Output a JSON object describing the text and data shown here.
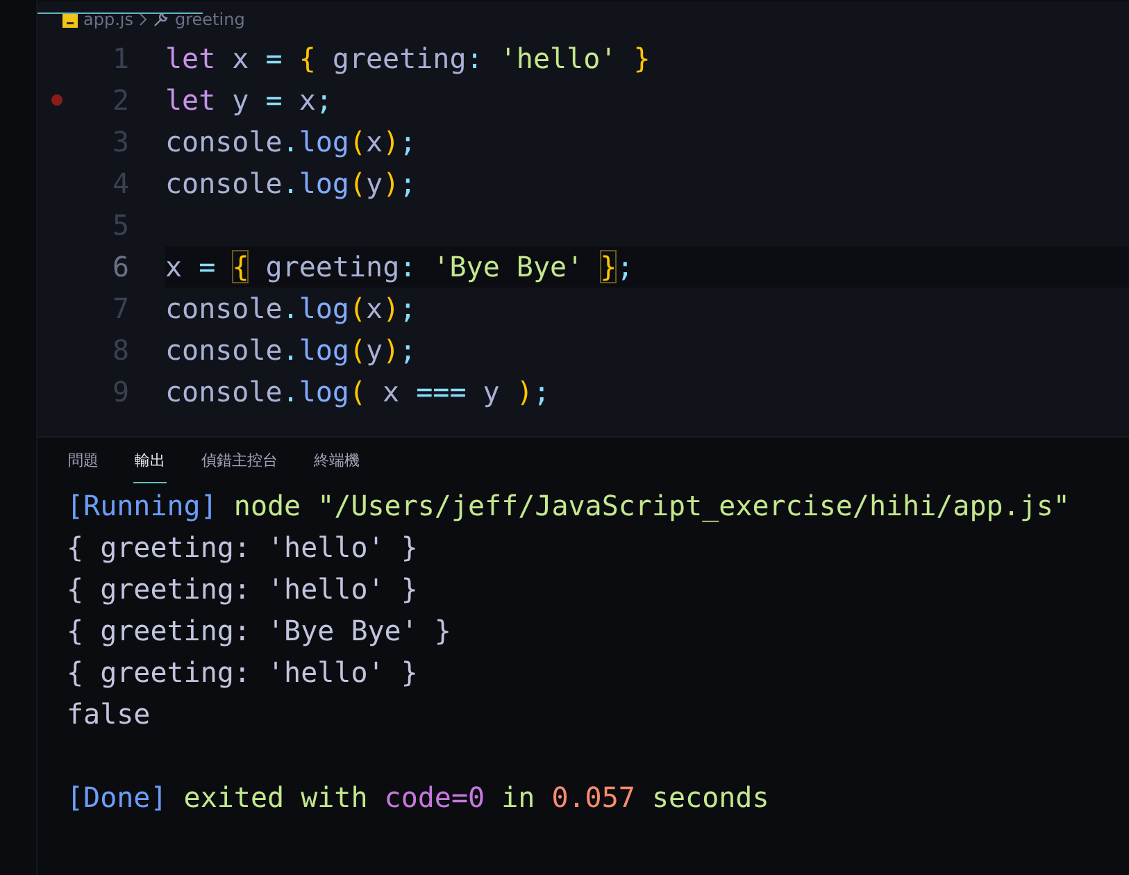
{
  "breadcrumb": {
    "file": "app.js",
    "symbol": "greeting"
  },
  "editor": {
    "lines": [
      {
        "number": "1",
        "breakpoint": false,
        "current": false,
        "tokens": [
          {
            "kind": "keyword",
            "text": "let"
          },
          {
            "kind": "plain",
            "text": " x "
          },
          {
            "kind": "operator",
            "text": "= "
          },
          {
            "kind": "brace",
            "text": "{",
            "matched": false
          },
          {
            "kind": "plain",
            "text": " greeting"
          },
          {
            "kind": "punct",
            "text": ": "
          },
          {
            "kind": "string",
            "text": "'hello' "
          },
          {
            "kind": "brace",
            "text": "}",
            "matched": false
          }
        ]
      },
      {
        "number": "2",
        "breakpoint": true,
        "current": false,
        "tokens": [
          {
            "kind": "keyword",
            "text": "let"
          },
          {
            "kind": "plain",
            "text": " y "
          },
          {
            "kind": "operator",
            "text": "="
          },
          {
            "kind": "plain",
            "text": " x"
          },
          {
            "kind": "punct",
            "text": ";"
          }
        ]
      },
      {
        "number": "3",
        "breakpoint": false,
        "current": false,
        "tokens": [
          {
            "kind": "plain",
            "text": "console"
          },
          {
            "kind": "punct",
            "text": "."
          },
          {
            "kind": "func",
            "text": "log"
          },
          {
            "kind": "brace",
            "text": "("
          },
          {
            "kind": "plain",
            "text": "x"
          },
          {
            "kind": "brace",
            "text": ")"
          },
          {
            "kind": "punct",
            "text": ";"
          }
        ]
      },
      {
        "number": "4",
        "breakpoint": false,
        "current": false,
        "tokens": [
          {
            "kind": "plain",
            "text": "console"
          },
          {
            "kind": "punct",
            "text": "."
          },
          {
            "kind": "func",
            "text": "log"
          },
          {
            "kind": "brace",
            "text": "("
          },
          {
            "kind": "plain",
            "text": "y"
          },
          {
            "kind": "brace",
            "text": ")"
          },
          {
            "kind": "punct",
            "text": ";"
          }
        ]
      },
      {
        "number": "5",
        "breakpoint": false,
        "current": false
      },
      {
        "number": "6",
        "breakpoint": false,
        "current": true,
        "tokens": [
          {
            "kind": "plain",
            "text": "x "
          },
          {
            "kind": "operator",
            "text": "= "
          },
          {
            "kind": "brace",
            "text": "{",
            "matched": true
          },
          {
            "kind": "plain",
            "text": " greeting"
          },
          {
            "kind": "punct",
            "text": ": "
          },
          {
            "kind": "string",
            "text": "'Bye Bye' "
          },
          {
            "kind": "brace",
            "text": "}",
            "matched": true
          },
          {
            "kind": "punct",
            "text": ";"
          }
        ]
      },
      {
        "number": "7",
        "breakpoint": false,
        "current": false,
        "tokens": [
          {
            "kind": "plain",
            "text": "console"
          },
          {
            "kind": "punct",
            "text": "."
          },
          {
            "kind": "func",
            "text": "log"
          },
          {
            "kind": "brace",
            "text": "("
          },
          {
            "kind": "plain",
            "text": "x"
          },
          {
            "kind": "brace",
            "text": ")"
          },
          {
            "kind": "punct",
            "text": ";"
          }
        ]
      },
      {
        "number": "8",
        "breakpoint": false,
        "current": false,
        "tokens": [
          {
            "kind": "plain",
            "text": "console"
          },
          {
            "kind": "punct",
            "text": "."
          },
          {
            "kind": "func",
            "text": "log"
          },
          {
            "kind": "brace",
            "text": "("
          },
          {
            "kind": "plain",
            "text": "y"
          },
          {
            "kind": "brace",
            "text": ")"
          },
          {
            "kind": "punct",
            "text": ";"
          }
        ]
      },
      {
        "number": "9",
        "breakpoint": false,
        "current": false,
        "tokens": [
          {
            "kind": "plain",
            "text": "console"
          },
          {
            "kind": "punct",
            "text": "."
          },
          {
            "kind": "func",
            "text": "log"
          },
          {
            "kind": "brace",
            "text": "("
          },
          {
            "kind": "plain",
            "text": " x "
          },
          {
            "kind": "operator",
            "text": "==="
          },
          {
            "kind": "plain",
            "text": " y "
          },
          {
            "kind": "brace",
            "text": ")"
          },
          {
            "kind": "punct",
            "text": ";"
          }
        ]
      }
    ]
  },
  "panel": {
    "tabs": [
      {
        "label": "問題",
        "selected": false
      },
      {
        "label": "輸出",
        "selected": true
      },
      {
        "label": "偵錯主控台",
        "selected": false
      },
      {
        "label": "終端機",
        "selected": false
      }
    ],
    "output": [
      {
        "tokens": [
          {
            "kind": "tag",
            "text": "[Running]"
          },
          {
            "kind": "info",
            "text": " node \"/Users/jeff/JavaScript_exercise/hihi/app.js\""
          }
        ]
      },
      {
        "tokens": [
          {
            "kind": "plain",
            "text": "{ greeting: 'hello' }"
          }
        ]
      },
      {
        "tokens": [
          {
            "kind": "plain",
            "text": "{ greeting: 'hello' }"
          }
        ]
      },
      {
        "tokens": [
          {
            "kind": "plain",
            "text": "{ greeting: 'Bye Bye' }"
          }
        ]
      },
      {
        "tokens": [
          {
            "kind": "plain",
            "text": "{ greeting: 'hello' }"
          }
        ]
      },
      {
        "tokens": [
          {
            "kind": "plain",
            "text": "false"
          }
        ]
      }
    ],
    "summary": {
      "tokens": [
        {
          "kind": "tag",
          "text": "[Done]"
        },
        {
          "kind": "info",
          "text": " exited with "
        },
        {
          "kind": "code",
          "text": "code=0"
        },
        {
          "kind": "info",
          "text": " in "
        },
        {
          "kind": "number",
          "text": "0.057"
        },
        {
          "kind": "info",
          "text": " seconds"
        }
      ]
    }
  }
}
